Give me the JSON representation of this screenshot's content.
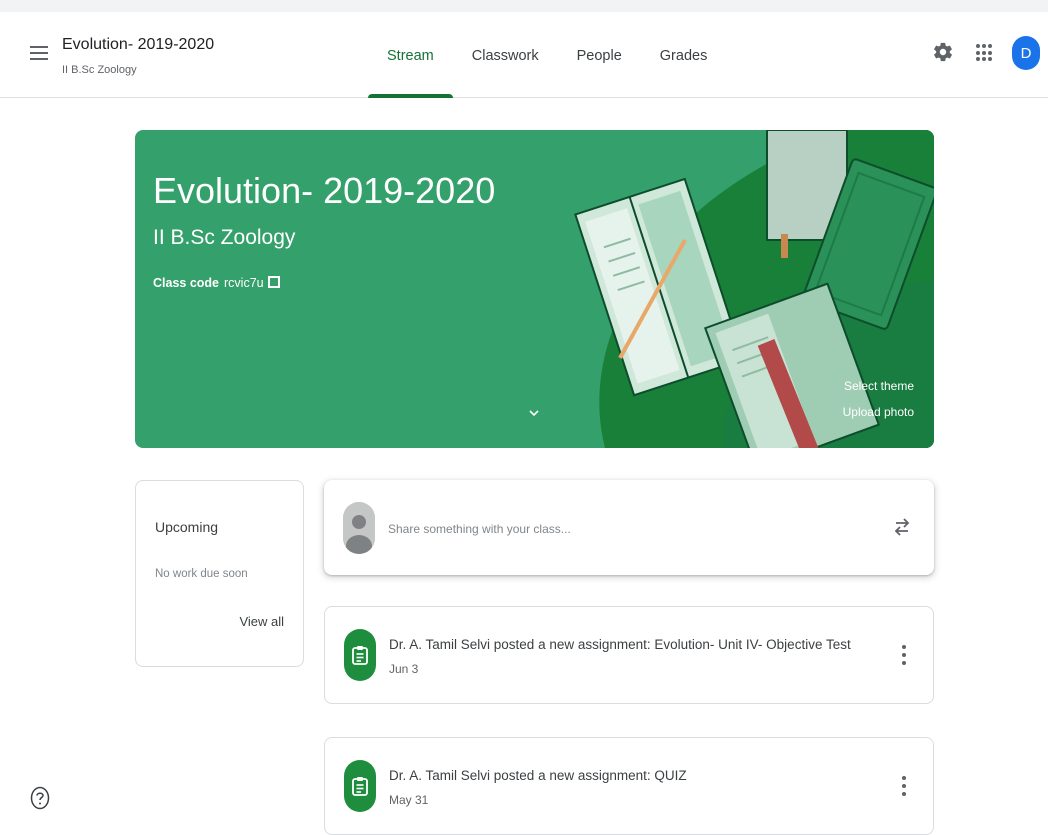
{
  "header": {
    "course_title": "Evolution- 2019-2020",
    "course_subtitle": "II B.Sc Zoology",
    "tabs": [
      {
        "label": "Stream",
        "active": true
      },
      {
        "label": "Classwork",
        "active": false
      },
      {
        "label": "People",
        "active": false
      },
      {
        "label": "Grades",
        "active": false
      }
    ],
    "avatar_letter": "D",
    "icons": [
      "hamburger-menu-icon",
      "gear-icon",
      "apps-grid-icon"
    ]
  },
  "banner": {
    "title": "Evolution- 2019-2020",
    "subtitle": "II B.Sc Zoology",
    "class_code_label": "Class code",
    "class_code": "rcvic7u",
    "select_theme": "Select theme",
    "upload_photo": "Upload photo",
    "color": "#34a06b"
  },
  "upcoming": {
    "title": "Upcoming",
    "empty_text": "No work due soon",
    "view_all": "View all"
  },
  "share": {
    "placeholder": "Share something with your class..."
  },
  "posts": [
    {
      "text": "Dr. A. Tamil Selvi posted a new assignment: Evolution- Unit IV- Objective Test",
      "date": "Jun 3"
    },
    {
      "text": "Dr. A. Tamil Selvi posted a new assignment: QUIZ",
      "date": "May 31"
    }
  ],
  "colors": {
    "accent": "#137333",
    "avatar": "#1a73e8",
    "assignment_icon": "#1e8e3e"
  }
}
